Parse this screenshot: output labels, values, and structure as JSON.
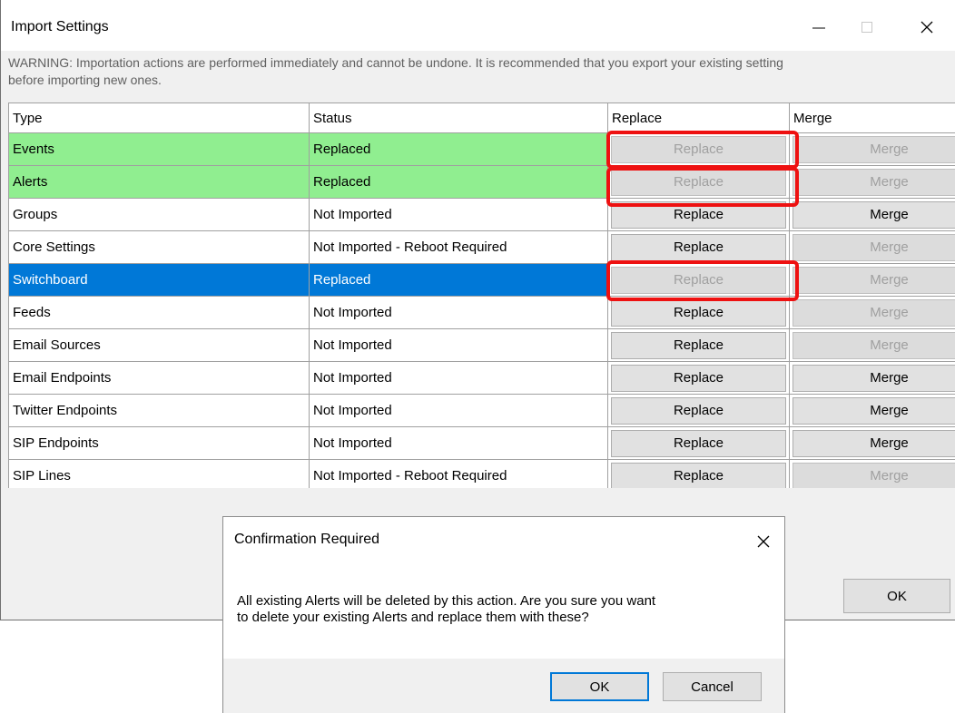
{
  "window": {
    "title": "Import Settings",
    "warning": "WARNING: Importation actions are performed immediately and cannot be undone.  It is recommended that you export your existing setting\nbefore importing new ones.",
    "ok_label": "OK"
  },
  "grid": {
    "columns": [
      "Type",
      "Status",
      "Replace",
      "Merge"
    ],
    "rows": [
      {
        "type": "Events",
        "status": "Replaced",
        "replace": "Replace",
        "merge": "Merge",
        "style": "green",
        "replace_enabled": false,
        "merge_enabled": false
      },
      {
        "type": "Alerts",
        "status": "Replaced",
        "replace": "Replace",
        "merge": "Merge",
        "style": "green",
        "replace_enabled": false,
        "merge_enabled": false
      },
      {
        "type": "Groups",
        "status": "Not Imported",
        "replace": "Replace",
        "merge": "Merge",
        "style": "normal",
        "replace_enabled": true,
        "merge_enabled": true
      },
      {
        "type": "Core Settings",
        "status": "Not Imported - Reboot Required",
        "replace": "Replace",
        "merge": "Merge",
        "style": "normal",
        "replace_enabled": true,
        "merge_enabled": false
      },
      {
        "type": "Switchboard",
        "status": "Replaced",
        "replace": "Replace",
        "merge": "Merge",
        "style": "selected",
        "replace_enabled": false,
        "merge_enabled": false
      },
      {
        "type": "Feeds",
        "status": "Not Imported",
        "replace": "Replace",
        "merge": "Merge",
        "style": "normal",
        "replace_enabled": true,
        "merge_enabled": false
      },
      {
        "type": "Email Sources",
        "status": "Not Imported",
        "replace": "Replace",
        "merge": "Merge",
        "style": "normal",
        "replace_enabled": true,
        "merge_enabled": false
      },
      {
        "type": "Email Endpoints",
        "status": "Not Imported",
        "replace": "Replace",
        "merge": "Merge",
        "style": "normal",
        "replace_enabled": true,
        "merge_enabled": true
      },
      {
        "type": "Twitter Endpoints",
        "status": "Not Imported",
        "replace": "Replace",
        "merge": "Merge",
        "style": "normal",
        "replace_enabled": true,
        "merge_enabled": true
      },
      {
        "type": "SIP Endpoints",
        "status": "Not Imported",
        "replace": "Replace",
        "merge": "Merge",
        "style": "normal",
        "replace_enabled": true,
        "merge_enabled": true
      },
      {
        "type": "SIP Lines",
        "status": "Not Imported - Reboot Required",
        "replace": "Replace",
        "merge": "Merge",
        "style": "normal",
        "replace_enabled": true,
        "merge_enabled": false
      }
    ]
  },
  "dialog": {
    "title": "Confirmation Required",
    "message": "All existing Alerts will be deleted by this action.  Are you sure you want\nto delete your existing Alerts and replace them with these?",
    "ok_label": "OK",
    "cancel_label": "Cancel"
  },
  "colors": {
    "replaced_row": "#90ee90",
    "selected_row": "#0078d7",
    "highlight": "#ee1111"
  }
}
